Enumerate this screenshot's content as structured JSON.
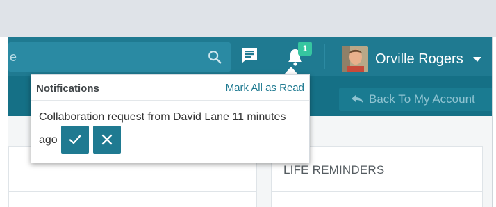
{
  "search": {
    "placeholder_fragment": "e"
  },
  "header": {
    "notification_count": "1",
    "user_name": "Orville Rogers"
  },
  "subbar": {
    "back_label": "Back To My Account"
  },
  "panels": {
    "right_title": "LIFE REMINDERS"
  },
  "notifications": {
    "title": "Notifications",
    "mark_all_label": "Mark All as Read",
    "message_line1": "Collaboration request from David Lane 11 minutes",
    "message_line2": "ago"
  },
  "icons": {
    "search": "search-icon",
    "chat": "chat-icon",
    "bell": "bell-icon",
    "caret": "caret-down-icon",
    "back": "back-arrow-icon",
    "accept": "check-icon",
    "reject": "close-icon"
  },
  "colors": {
    "header_bg": "#1f7a91",
    "subbar_bg": "#157086",
    "badge": "#36c6a0",
    "button": "#1f7a91"
  }
}
